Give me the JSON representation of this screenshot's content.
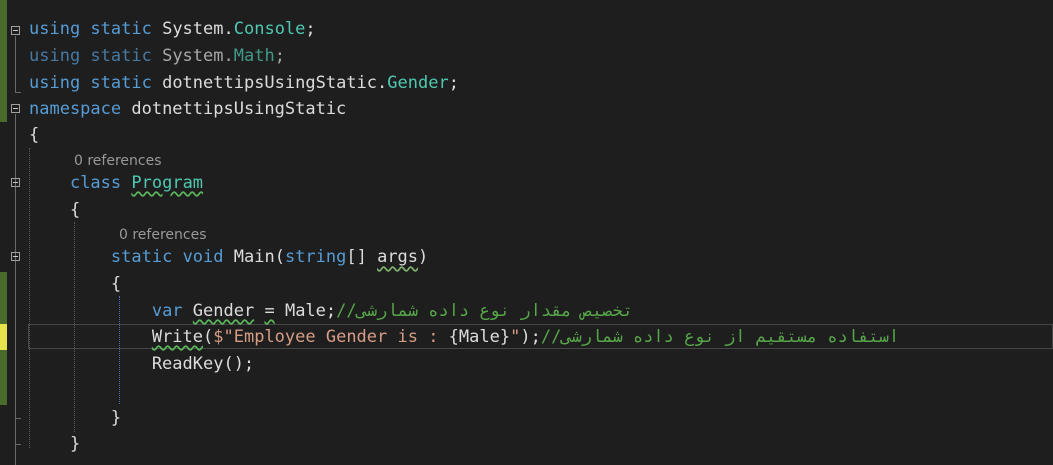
{
  "editor": {
    "codelens": [
      "0 references",
      "0 references"
    ],
    "lines": [
      {
        "t1": "using",
        "t2": " static ",
        "t3": "System",
        "t4": ".",
        "t5": "Console",
        "t6": ";"
      },
      {
        "t1": "using",
        "t2": " static ",
        "t3": "System",
        "t4": ".",
        "t5": "Math",
        "t6": ";"
      },
      {
        "t1": "using",
        "t2": " static ",
        "t3": "dotnettipsUsingStatic",
        "t4": ".",
        "t5": "Gender",
        "t6": ";"
      },
      {
        "t1": "namespace",
        "t2": " dotnettipsUsingStatic"
      },
      {
        "t1": "{"
      },
      {
        "t1": "    ",
        "t2": "class",
        "t3": " ",
        "t4": "Program"
      },
      {
        "t1": "    {"
      },
      {
        "t1": "        ",
        "t2": "static",
        "t3": " ",
        "t4": "void",
        "t5": " Main(",
        "t6": "string",
        "t7": "[] ",
        "t8": "args",
        "t9": ")"
      },
      {
        "t1": "        {"
      },
      {
        "t1": "            ",
        "t2": "var",
        "t3": " ",
        "t4": "Gender",
        "t5": " ",
        "t6": "=",
        "t7": " Male;",
        "t8": "//تخصیص مقدار نوع داده شمارشی"
      },
      {
        "t1": "            ",
        "t2": "Write",
        "t3": "(",
        "t4": "$\"Employee Gender is : ",
        "t5": "{Male}",
        "t6": "\"",
        "t7": ");",
        "t8": "//استفاده مستقیم از نوع داده شمارشی"
      },
      {
        "t1": "            ReadKey();"
      },
      {
        "t1": ""
      },
      {
        "t1": "        }"
      },
      {
        "t1": "    }"
      }
    ]
  }
}
